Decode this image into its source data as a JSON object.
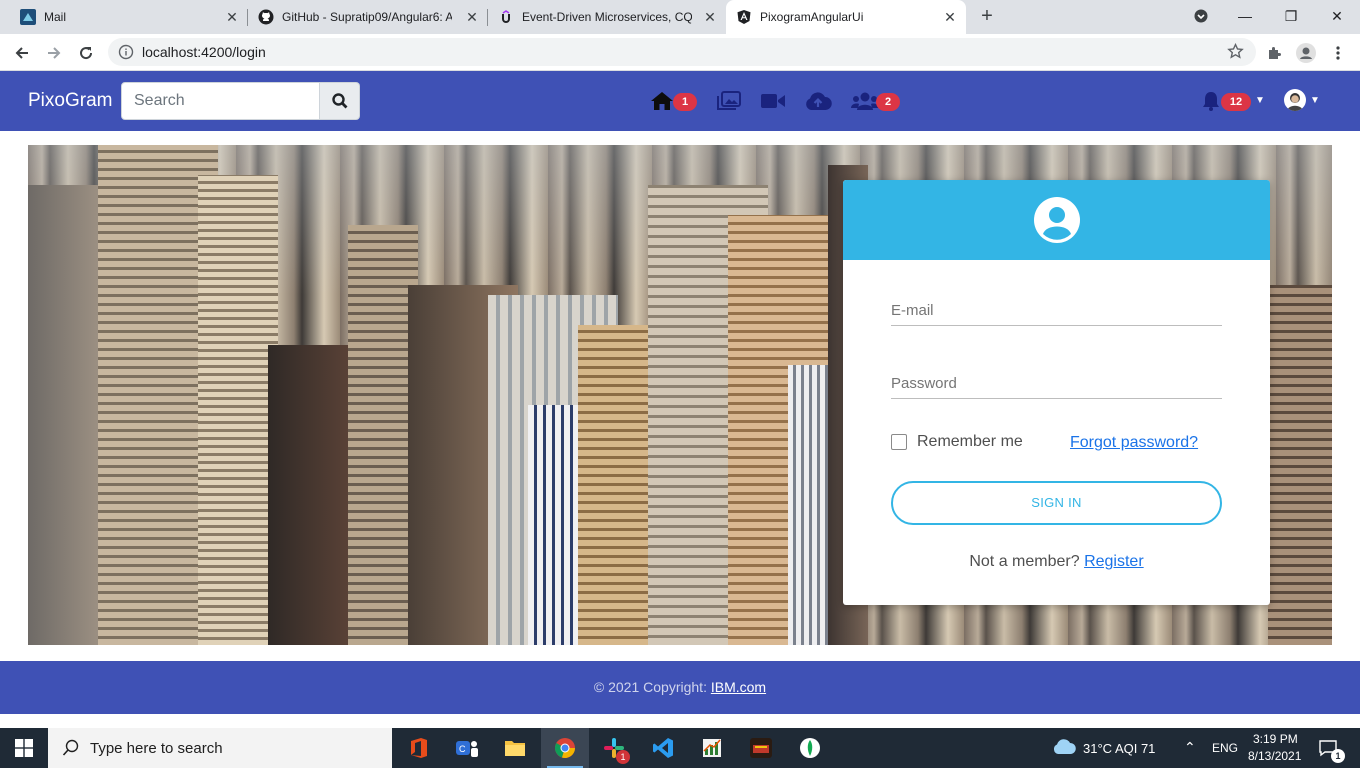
{
  "browser": {
    "tabs": [
      {
        "title": "Mail",
        "icon": "mail-app-icon"
      },
      {
        "title": "GitHub - Supratip09/Angular6: A",
        "icon": "github-icon"
      },
      {
        "title": "Event-Driven Microservices, CQR",
        "icon": "udemy-icon"
      },
      {
        "title": "PixogramAngularUi",
        "icon": "angular-icon",
        "active": true
      }
    ],
    "url": "localhost:4200/login"
  },
  "navbar": {
    "brand": "PixoGram",
    "search_placeholder": "Search",
    "home_badge": "1",
    "friends_badge": "2",
    "notifications_badge": "12",
    "color": "#3f51b5"
  },
  "login": {
    "email_placeholder": "E-mail",
    "password_placeholder": "Password",
    "remember_label": "Remember me",
    "forgot_label": "Forgot password?",
    "signin_label": "SIGN IN",
    "not_member": "Not a member?",
    "register_label": "Register",
    "accent": "#33b5e5"
  },
  "footer": {
    "copyright": "© 2021 Copyright:",
    "link": "IBM.com"
  },
  "taskbar": {
    "search_placeholder": "Type here to search",
    "weather": "31°C  AQI 71",
    "language": "ENG",
    "time": "3:19 PM",
    "date": "8/13/2021",
    "notifications": "1",
    "chat_badge": "1"
  }
}
